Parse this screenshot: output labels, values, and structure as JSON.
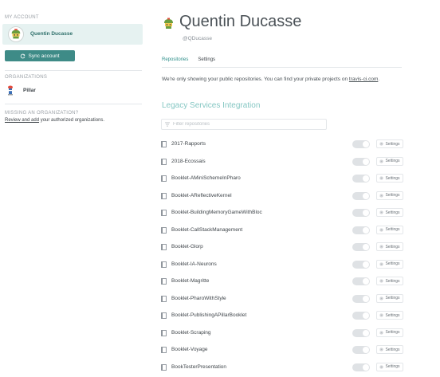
{
  "sidebar": {
    "my_account_label": "MY ACCOUNT",
    "account_name": "Quentin Ducasse",
    "sync_button_label": "Sync account",
    "organizations_label": "ORGANIZATIONS",
    "organizations": [
      {
        "name": "Pillar"
      }
    ],
    "missing_label": "MISSING AN ORGANIZATION?",
    "missing_link": "Review and add",
    "missing_text": " your authorized organizations."
  },
  "profile": {
    "name": "Quentin Ducasse",
    "handle": "@QDucasse"
  },
  "tabs": [
    {
      "label": "Repositories",
      "active": true
    },
    {
      "label": "Settings",
      "active": false
    }
  ],
  "notice": {
    "text": "We're only showing your public repositories. You can find your private projects on ",
    "link": "travis-ci.com",
    "suffix": "."
  },
  "organization_title": "Legacy Services Integration",
  "filter": {
    "placeholder": "Filter repositories",
    "value": ""
  },
  "settings_label": "Settings",
  "repositories": [
    {
      "name": "2017-Rapports",
      "enabled": false
    },
    {
      "name": "2018-Ecossais",
      "enabled": false
    },
    {
      "name": "Booklet-AMiniSchemeInPharo",
      "enabled": false
    },
    {
      "name": "Booklet-AReflectiveKernel",
      "enabled": false
    },
    {
      "name": "Booklet-BuildingMemoryGameWithBloc",
      "enabled": false
    },
    {
      "name": "Booklet-CallStackManagement",
      "enabled": false
    },
    {
      "name": "Booklet-Glorp",
      "enabled": false
    },
    {
      "name": "Booklet-IA-Neurons",
      "enabled": false
    },
    {
      "name": "Booklet-Magritte",
      "enabled": false
    },
    {
      "name": "Booklet-PharoWithStyle",
      "enabled": false
    },
    {
      "name": "Booklet-PublishingAPillarBooklet",
      "enabled": false
    },
    {
      "name": "Booklet-Scraping",
      "enabled": false
    },
    {
      "name": "Booklet-Voyage",
      "enabled": false
    },
    {
      "name": "BookTesterPresentation",
      "enabled": false
    }
  ],
  "colors": {
    "accent": "#3e8b87",
    "account_bg": "#e6f2f1",
    "org_title": "#85c7c3",
    "toggle_off": "#dfe2e5"
  },
  "icons": {
    "avatar": "mascot-avatar-icon",
    "sync": "sync-icon",
    "organization": "pillar-org-icon",
    "filter": "filter-icon",
    "repository": "book-icon",
    "settings": "gear-icon"
  }
}
